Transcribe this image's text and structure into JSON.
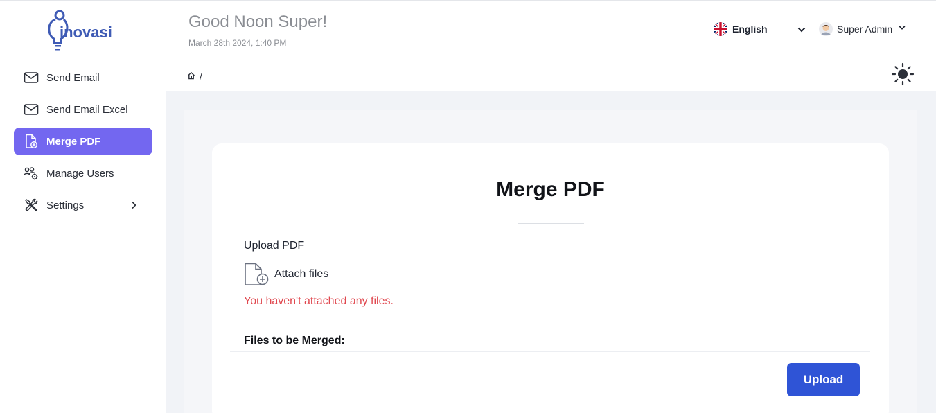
{
  "app": {
    "logo_text": "inovasi"
  },
  "sidebar": {
    "items": [
      {
        "label": "Send Email",
        "icon": "mail-icon",
        "active": false
      },
      {
        "label": "Send Email Excel",
        "icon": "mail-icon",
        "active": false
      },
      {
        "label": "Merge PDF",
        "icon": "file-plus-icon",
        "active": true
      },
      {
        "label": "Manage Users",
        "icon": "users-gear-icon",
        "active": false
      },
      {
        "label": "Settings",
        "icon": "tools-icon",
        "active": false,
        "has_submenu": true
      }
    ]
  },
  "header": {
    "greeting": "Good Noon Super!",
    "datetime": "March 28th 2024, 1:40 PM",
    "language": "English",
    "user_name": "Super Admin"
  },
  "breadcrumb": {
    "separator": "/"
  },
  "main": {
    "title": "Merge PDF",
    "upload_label": "Upload PDF",
    "attach_label": "Attach files",
    "error_message": "You haven't attached any files.",
    "files_heading": "Files to be Merged:",
    "upload_button": "Upload"
  },
  "colors": {
    "accent": "#7367f0",
    "primary_button": "#2f54d6",
    "error": "#e0474e",
    "logo_blue": "#3f5bb5"
  }
}
